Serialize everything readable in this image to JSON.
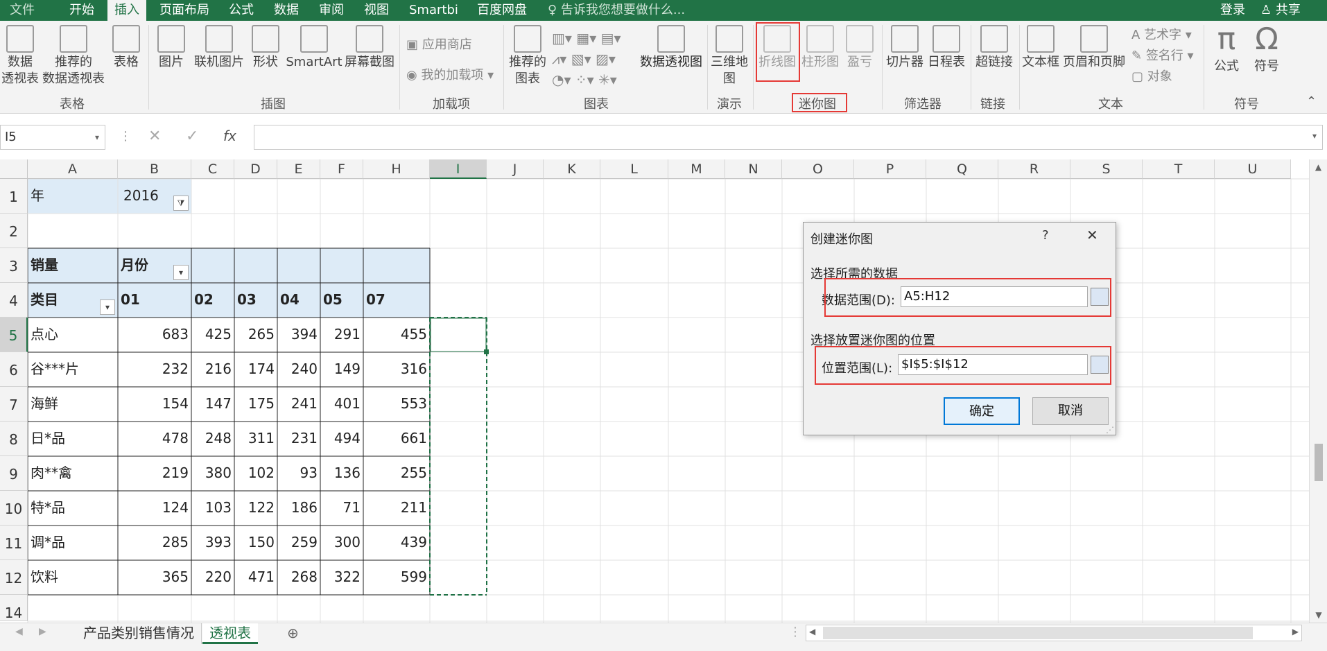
{
  "tabs": [
    "文件",
    "开始",
    "插入",
    "页面布局",
    "公式",
    "数据",
    "审阅",
    "视图",
    "Smartbi",
    "百度网盘"
  ],
  "active_tab": "插入",
  "tell_me": "告诉我您想要做什么...",
  "login": "登录",
  "share": "共享",
  "ribbon": {
    "pivot_table_l1": "数据",
    "pivot_table_l2": "透视表",
    "recommended_pivot_l1": "推荐的",
    "recommended_pivot_l2": "数据透视表",
    "table": "表格",
    "group_tables": "表格",
    "picture": "图片",
    "online_picture": "联机图片",
    "shapes": "形状",
    "smartart": "SmartArt",
    "screenshot": "屏幕截图",
    "group_illustrations": "插图",
    "app_store": "应用商店",
    "my_addins": "我的加载项",
    "group_addins": "加载项",
    "recommended_charts_l1": "推荐的",
    "recommended_charts_l2": "图表",
    "pivot_chart": "数据透视图",
    "group_charts": "图表",
    "map3d_l1": "三维地",
    "map3d_l2": "图",
    "group_tours": "演示",
    "sparkline_line": "折线图",
    "sparkline_column": "柱形图",
    "sparkline_winloss": "盈亏",
    "group_sparklines": "迷你图",
    "slicer": "切片器",
    "timeline": "日程表",
    "group_filters": "筛选器",
    "hyperlink": "超链接",
    "group_links": "链接",
    "textbox": "文本框",
    "header_footer": "页眉和页脚",
    "wordart": "艺术字",
    "signature": "签名行",
    "object": "对象",
    "group_text": "文本",
    "equation": "公式",
    "symbol": "符号",
    "group_symbols": "符号"
  },
  "formula_bar": {
    "name_box": "I5",
    "fx": "fx",
    "content": ""
  },
  "columns": [
    "A",
    "B",
    "C",
    "D",
    "E",
    "F",
    "H",
    "I",
    "J",
    "K",
    "L",
    "M",
    "N",
    "O",
    "P",
    "Q",
    "R",
    "S",
    "T",
    "U"
  ],
  "rows": [
    "1",
    "2",
    "3",
    "4",
    "5",
    "6",
    "7",
    "8",
    "9",
    "10",
    "11",
    "12",
    "14"
  ],
  "cells": {
    "a1": "年",
    "b1": "2016",
    "a3": "销量",
    "b3": "月份",
    "a4": "类目",
    "headers": [
      "01",
      "02",
      "03",
      "04",
      "05",
      "07"
    ],
    "data": [
      {
        "cat": "点心",
        "v": [
          "683",
          "425",
          "265",
          "394",
          "291",
          "455"
        ]
      },
      {
        "cat": "谷***片",
        "v": [
          "232",
          "216",
          "174",
          "240",
          "149",
          "316"
        ]
      },
      {
        "cat": "海鲜",
        "v": [
          "154",
          "147",
          "175",
          "241",
          "401",
          "553"
        ]
      },
      {
        "cat": "日*品",
        "v": [
          "478",
          "248",
          "311",
          "231",
          "494",
          "661"
        ]
      },
      {
        "cat": "肉**禽",
        "v": [
          "219",
          "380",
          "102",
          "93",
          "136",
          "255"
        ]
      },
      {
        "cat": "特*品",
        "v": [
          "124",
          "103",
          "122",
          "186",
          "71",
          "211"
        ]
      },
      {
        "cat": "调*品",
        "v": [
          "285",
          "393",
          "150",
          "259",
          "300",
          "439"
        ]
      },
      {
        "cat": "饮料",
        "v": [
          "365",
          "220",
          "471",
          "268",
          "322",
          "599"
        ]
      }
    ]
  },
  "dialog": {
    "title": "创建迷你图",
    "help": "?",
    "close": "✕",
    "section1": "选择所需的数据",
    "data_range_label": "数据范围(D):",
    "data_range_value": "A5:H12",
    "section2": "选择放置迷你图的位置",
    "location_label": "位置范围(L):",
    "location_value": "$I$5:$I$12",
    "ok": "确定",
    "cancel": "取消"
  },
  "sheets": [
    "产品类别销售情况",
    "透视表"
  ],
  "active_sheet": "透视表",
  "colors": {
    "brand": "#217346",
    "pivot_header": "#ddebf7",
    "highlight": "#e53935"
  }
}
